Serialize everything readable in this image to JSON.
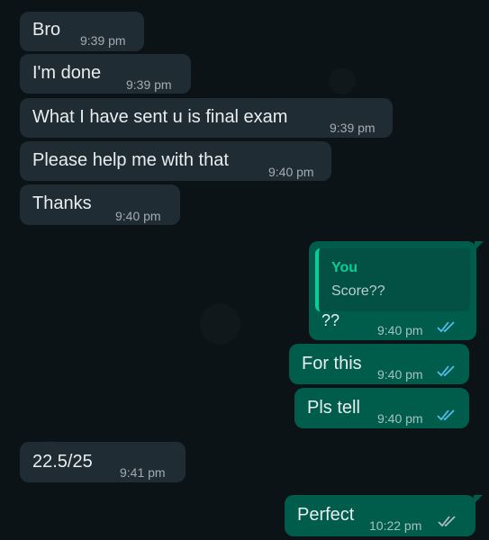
{
  "colors": {
    "incoming_bubble": "#202c33",
    "outgoing_bubble": "#005c4b",
    "read_ticks": "#53bdeb",
    "quote_accent": "#06cf9c"
  },
  "messages": [
    {
      "direction": "incoming",
      "text": "Bro",
      "time": "9:39 pm"
    },
    {
      "direction": "incoming",
      "text": "I'm done",
      "time": "9:39 pm"
    },
    {
      "direction": "incoming",
      "text": "What I have sent u is final exam",
      "time": "9:39 pm"
    },
    {
      "direction": "incoming",
      "text": "Please help me with that",
      "time": "9:40 pm"
    },
    {
      "direction": "incoming",
      "text": "Thanks",
      "time": "9:40 pm"
    },
    {
      "direction": "outgoing",
      "quote": {
        "author": "You",
        "text": "Score??"
      },
      "text": "??",
      "time": "9:40 pm",
      "status": "read"
    },
    {
      "direction": "outgoing",
      "text": "For this",
      "time": "9:40 pm",
      "status": "read"
    },
    {
      "direction": "outgoing",
      "text": "Pls tell",
      "time": "9:40 pm",
      "status": "read"
    },
    {
      "direction": "incoming",
      "text": "22.5/25",
      "time": "9:41 pm"
    },
    {
      "direction": "outgoing",
      "text": "Perfect",
      "time": "10:22 pm",
      "status": "delivered"
    }
  ]
}
